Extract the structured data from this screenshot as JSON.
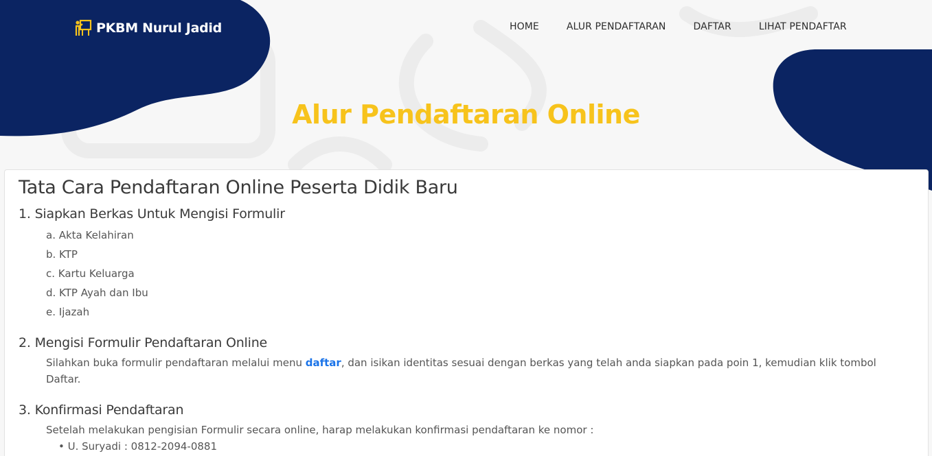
{
  "colors": {
    "navy": "#0b2462",
    "accent": "#f7c31c",
    "link": "#1a73e8"
  },
  "brand": {
    "name": "PKBM Nurul Jadid",
    "icon": "teacher-board-icon"
  },
  "nav": {
    "items": [
      "HOME",
      "ALUR PENDAFTARAN",
      "DAFTAR",
      "LIHAT PENDAFTAR"
    ]
  },
  "hero": {
    "title": "Alur Pendaftaran Online"
  },
  "card": {
    "title": "Tata Cara Pendaftaran Online Peserta Didik Baru",
    "step1": {
      "title": "1. Siapkan Berkas Untuk Mengisi Formulir",
      "items": [
        "a. Akta Kelahiran",
        "b. KTP",
        "c. Kartu Keluarga",
        "d. KTP Ayah dan Ibu",
        "e. Ijazah"
      ]
    },
    "step2": {
      "title": "2. Mengisi Formulir Pendaftaran Online",
      "text_before": "Silahkan buka formulir pendaftaran melalui menu ",
      "link": "daftar",
      "text_after": ", dan isikan identitas sesuai dengan berkas yang telah anda siapkan pada poin 1, kemudian klik tombol Daftar."
    },
    "step3": {
      "title": "3. Konfirmasi Pendaftaran",
      "text": "Setelah melakukan pengisian Formulir secara online, harap melakukan konfirmasi pendaftaran ke nomor :",
      "contact": "• U. Suryadi : 0812-2094-0881"
    }
  }
}
